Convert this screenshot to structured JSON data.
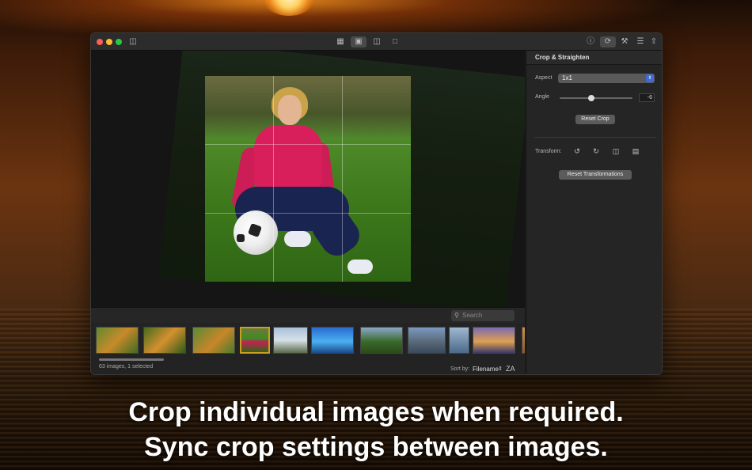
{
  "titlebar": {
    "icons": [
      "sidebar-icon",
      "grid-view-icon",
      "single-view-icon",
      "split-view-icon",
      "image-view-icon",
      "info-icon",
      "sync-icon",
      "tools-icon",
      "adjust-icon",
      "share-icon"
    ]
  },
  "filmstrip": {
    "search_placeholder": "Search",
    "selected_index": 3
  },
  "status": {
    "count": "63 images, 1 selected",
    "sort_label": "Sort by:",
    "sort_value": "Filename",
    "sort_order": "ZA"
  },
  "panel": {
    "title": "Crop & Straighten",
    "aspect_label": "Aspect",
    "aspect_value": "1x1",
    "angle_label": "Angle",
    "angle_value": "-6",
    "reset_crop": "Reset Crop",
    "transform_label": "Transform:",
    "reset_transformations": "Reset Transformations"
  },
  "caption": {
    "line1": "Crop individual images when required.",
    "line2": "Sync crop settings between images."
  }
}
